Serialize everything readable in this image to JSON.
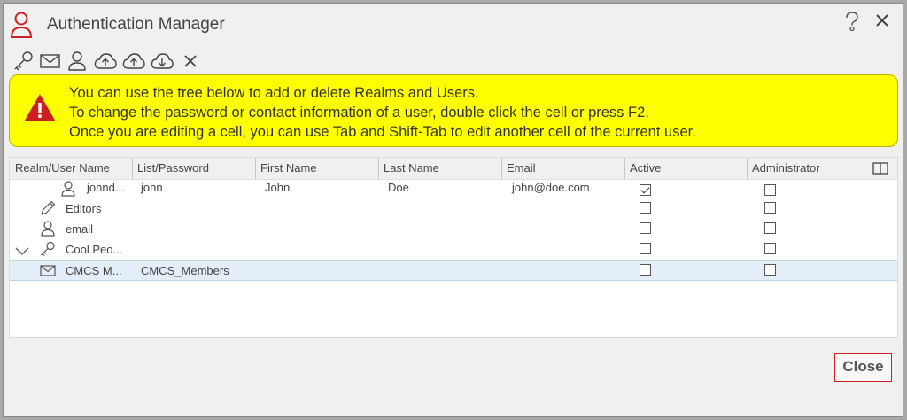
{
  "dialog": {
    "title": "Authentication Manager",
    "accent_color": "#cc1f1f"
  },
  "toolbar": {
    "buttons": [
      {
        "name": "key-icon"
      },
      {
        "name": "mail-icon"
      },
      {
        "name": "user-icon"
      },
      {
        "name": "cloud-upload-icon"
      },
      {
        "name": "cloud-upload-alt-icon"
      },
      {
        "name": "cloud-download-icon"
      },
      {
        "name": "delete-icon"
      }
    ]
  },
  "banner": {
    "background": "#ffff00",
    "lines": [
      "You can use the tree below to add or delete Realms and Users.",
      "To change the password or contact information of a user, double click the cell or press F2.",
      "Once you are editing a cell, you can use Tab and Shift-Tab to edit another cell of the current user."
    ]
  },
  "grid": {
    "columns": [
      "Realm/User Name",
      "List/Password",
      "First Name",
      "Last Name",
      "Email",
      "Active",
      "Administrator"
    ],
    "rows": [
      {
        "icon": "user-icon",
        "name": "johnd...",
        "list": "john",
        "first": "John",
        "last": "Doe",
        "email": "john@doe.com",
        "active": true,
        "admin": false
      },
      {
        "icon": "pencil-icon",
        "name": "Editors",
        "list": "",
        "first": "",
        "last": "",
        "email": "",
        "active": false,
        "admin": false
      },
      {
        "icon": "user-icon",
        "name": "email",
        "list": "",
        "first": "",
        "last": "",
        "email": "",
        "active": false,
        "admin": false
      },
      {
        "icon": "key-icon",
        "name": "Cool Peo...",
        "list": "",
        "first": "",
        "last": "",
        "email": "",
        "active": false,
        "admin": false,
        "expanded": true
      },
      {
        "icon": "mail-icon",
        "name": "CMCS M...",
        "list": "CMCS_Members",
        "first": "",
        "last": "",
        "email": "",
        "active": false,
        "admin": false,
        "selected": true
      }
    ]
  },
  "footer": {
    "close_label": "Close"
  }
}
